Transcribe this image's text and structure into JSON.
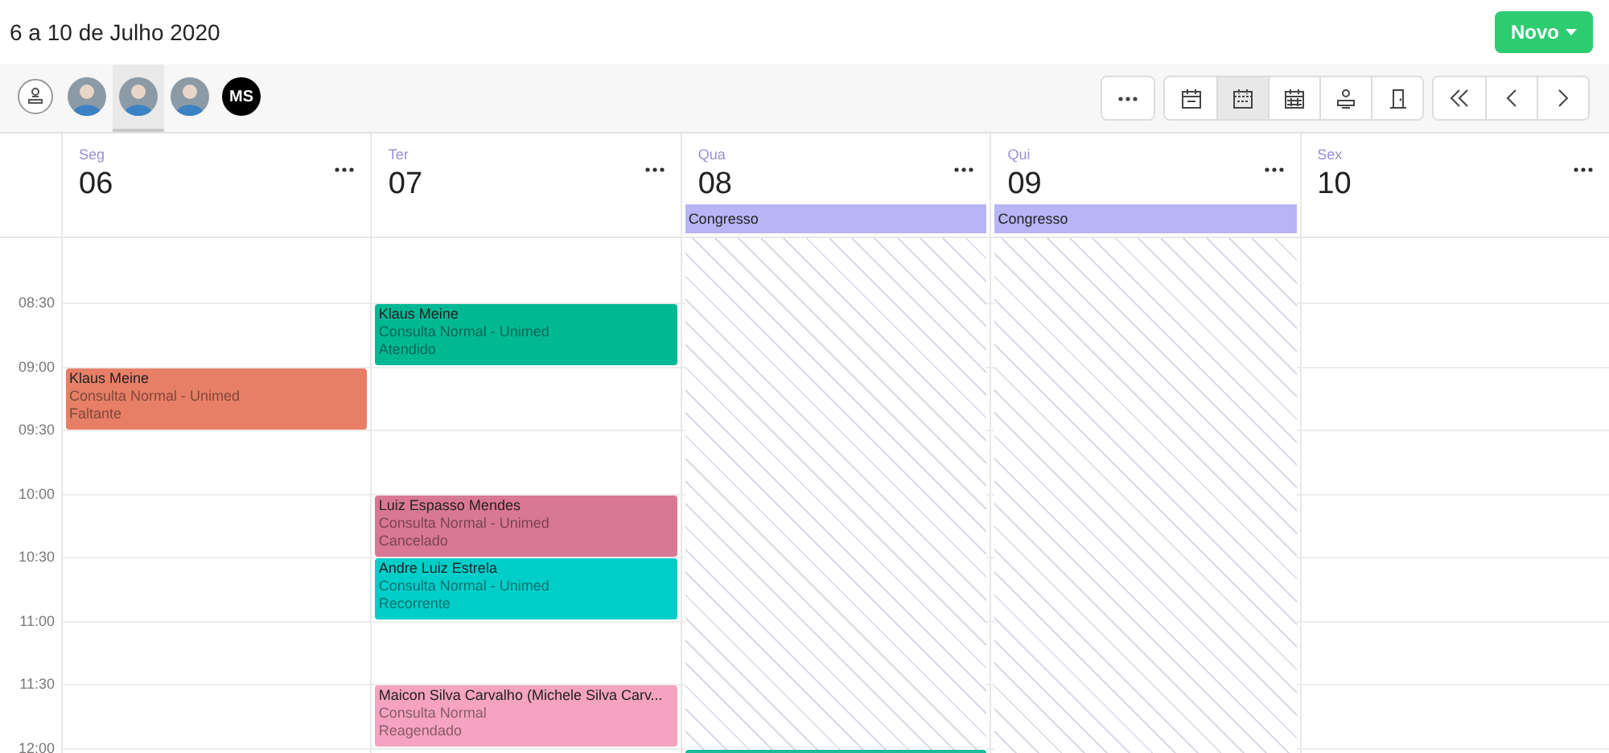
{
  "title": "6 a 10 de Julho 2020",
  "new_button": "Novo",
  "professionals": [
    {
      "kind": "icon",
      "selected": false
    },
    {
      "kind": "photo",
      "selected": false
    },
    {
      "kind": "photo",
      "selected": true
    },
    {
      "kind": "photo",
      "selected": false
    },
    {
      "kind": "initials",
      "initials": "MS",
      "selected": false
    }
  ],
  "toolbar_groups": [
    [
      {
        "kind": "more",
        "selected": false
      }
    ],
    [
      {
        "kind": "day",
        "selected": false
      },
      {
        "kind": "week",
        "selected": true
      },
      {
        "kind": "month",
        "selected": false
      },
      {
        "kind": "person",
        "selected": false
      },
      {
        "kind": "door",
        "selected": false
      }
    ],
    [
      {
        "kind": "first",
        "selected": false
      },
      {
        "kind": "prev",
        "selected": false
      },
      {
        "kind": "next",
        "selected": false
      }
    ]
  ],
  "times": [
    "08:30",
    "09:00",
    "09:30",
    "10:00",
    "10:30",
    "11:00",
    "11:30",
    "12:00"
  ],
  "days": [
    {
      "weekday": "Seg",
      "date": "06",
      "unavailable": false,
      "slots": [
        {
          "kind": "empty"
        },
        {
          "kind": "empty"
        },
        {
          "kind": "appointment",
          "name": "Klaus Meine",
          "service": "Consulta Normal - Unimed",
          "status": "Faltante",
          "color": "#e77f67"
        }
      ]
    },
    {
      "weekday": "Ter",
      "date": "07",
      "unavailable": false,
      "slots": [
        {
          "kind": "empty"
        },
        {
          "kind": "appointment",
          "name": "Klaus Meine",
          "service": "Consulta Normal - Unimed",
          "status": "Atendido",
          "color": "#00b894"
        },
        {
          "kind": "empty"
        },
        {
          "kind": "empty"
        },
        {
          "kind": "appointment",
          "name": "Luiz Espasso Mendes",
          "service": "Consulta Normal - Unimed",
          "status": "Cancelado",
          "color": "#d97894"
        },
        {
          "kind": "appointment",
          "name": "Andre Luiz Estrela",
          "service": "Consulta Normal - Unimed",
          "status": "Recorrente",
          "color": "#00cec9"
        },
        {
          "kind": "empty"
        },
        {
          "kind": "appointment",
          "name": "Maicon Silva Carvalho (Michele Silva Carv...",
          "service": "Consulta Normal",
          "status": "Reagendado",
          "color": "#f5a3c0"
        }
      ]
    },
    {
      "weekday": "Qua",
      "date": "08",
      "unavailable": true,
      "all_day": [
        "Congresso"
      ],
      "slots": [
        {
          "kind": "empty"
        },
        {
          "kind": "empty"
        },
        {
          "kind": "empty"
        },
        {
          "kind": "empty"
        },
        {
          "kind": "empty"
        },
        {
          "kind": "empty"
        },
        {
          "kind": "empty"
        },
        {
          "kind": "empty"
        },
        {
          "kind": "appointment",
          "color": "#1abc9c"
        }
      ]
    },
    {
      "weekday": "Qui",
      "date": "09",
      "unavailable": true,
      "all_day": [
        "Congresso"
      ]
    },
    {
      "weekday": "Sex",
      "date": "10",
      "unavailable": false
    }
  ]
}
